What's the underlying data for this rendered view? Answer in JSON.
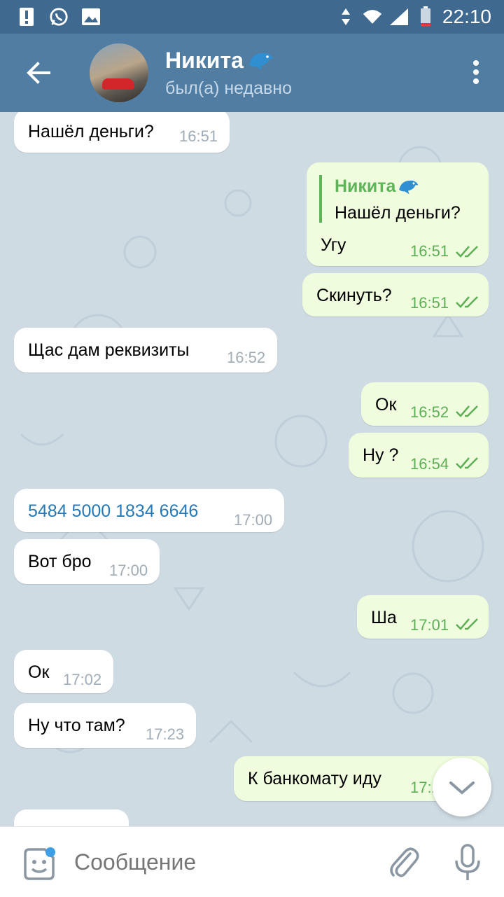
{
  "status_bar": {
    "time": "22:10"
  },
  "header": {
    "name": "Никита",
    "status": "был(а) недавно"
  },
  "messages": [
    {
      "dir": "in",
      "text": "Нашёл деньги?",
      "time": "16:51"
    },
    {
      "dir": "out",
      "reply_name": "Никита",
      "reply_text": "Нашёл деньги?",
      "text": "Угу",
      "time": "16:51"
    },
    {
      "dir": "out",
      "text": "Скинуть?",
      "time": "16:51"
    },
    {
      "dir": "in",
      "text": "Щас дам реквизиты",
      "time": "16:52"
    },
    {
      "dir": "out",
      "text": "Ок",
      "time": "16:52"
    },
    {
      "dir": "out",
      "text": "Ну ?",
      "time": "16:54"
    },
    {
      "dir": "in",
      "text": "5484 5000 1834 6646",
      "time": "17:00",
      "link": true
    },
    {
      "dir": "in",
      "text": "Вот бро",
      "time": "17:00"
    },
    {
      "dir": "out",
      "text": "Ша",
      "time": "17:01"
    },
    {
      "dir": "in",
      "text": "Ок",
      "time": "17:02"
    },
    {
      "dir": "in",
      "text": "Ну что там?",
      "time": "17:23"
    },
    {
      "dir": "out",
      "text": "К банкомату иду",
      "time": "17:2"
    }
  ],
  "input": {
    "placeholder": "Сообщение"
  },
  "colors": {
    "header": "#517da2",
    "status_bar": "#40698f",
    "out_bubble": "#effdde",
    "in_bubble": "#ffffff",
    "accent_green": "#5fae57",
    "link": "#2678b6"
  },
  "icons": {
    "back": "arrow-left-icon",
    "menu": "more-vertical-icon",
    "sticker": "sticker-icon",
    "attach": "paperclip-icon",
    "mic": "microphone-icon",
    "scroll": "chevron-down-icon",
    "title_emoji": "dolphin-icon"
  }
}
